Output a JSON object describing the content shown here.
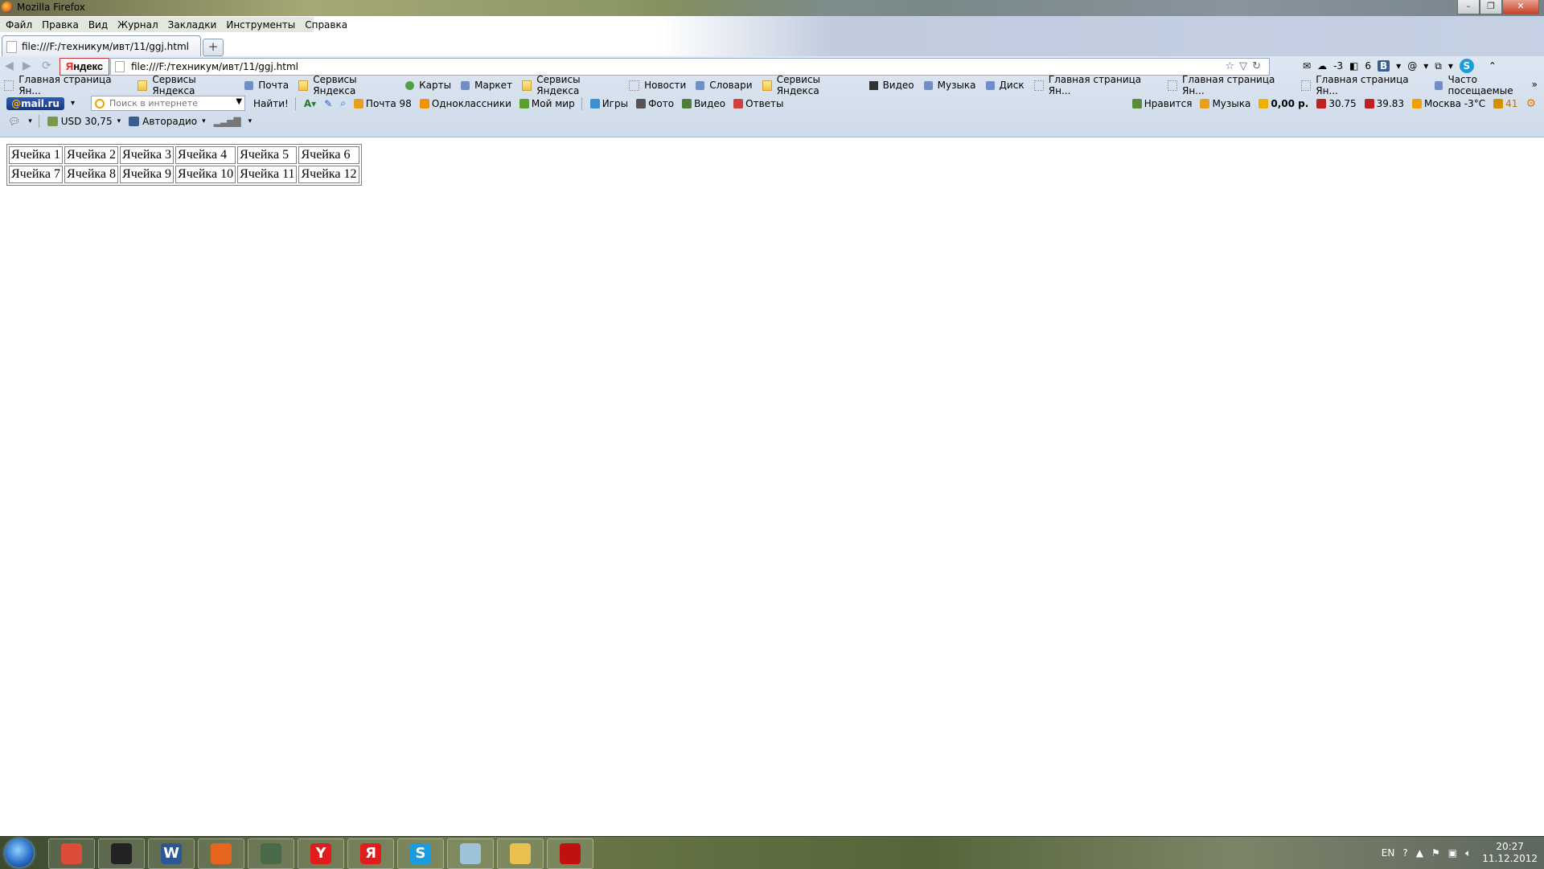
{
  "window": {
    "title": "Mozilla Firefox"
  },
  "menu": [
    "Файл",
    "Правка",
    "Вид",
    "Журнал",
    "Закладки",
    "Инструменты",
    "Справка"
  ],
  "tab": {
    "label": "file:///F:/техникум/ивт/11/ggj.html",
    "new_tab": "+"
  },
  "nav": {
    "yandex_label_first": "Я",
    "yandex_label_rest": "ндекс",
    "url": "file:///F:/техникум/ивт/11/ggj.html",
    "weather": "-3",
    "notif_count": "6"
  },
  "bookmarks": [
    {
      "label": "Главная страница Ян...",
      "icon": "page-icon"
    },
    {
      "label": "Сервисы Яндекса",
      "icon": "folder-icon"
    },
    {
      "label": "Почта",
      "icon": "mail-icon"
    },
    {
      "label": "Сервисы Яндекса",
      "icon": "folder-icon"
    },
    {
      "label": "Карты",
      "icon": "maps-icon"
    },
    {
      "label": "Маркет",
      "icon": "market-icon"
    },
    {
      "label": "Сервисы Яндекса",
      "icon": "folder-icon"
    },
    {
      "label": "Новости",
      "icon": "news-icon"
    },
    {
      "label": "Словари",
      "icon": "dictionary-icon"
    },
    {
      "label": "Сервисы Яндекса",
      "icon": "folder-icon"
    },
    {
      "label": "Видео",
      "icon": "video-icon"
    },
    {
      "label": "Музыка",
      "icon": "music-icon"
    },
    {
      "label": "Диск",
      "icon": "disk-icon"
    },
    {
      "label": "Главная страница Ян...",
      "icon": "page-icon"
    },
    {
      "label": "Главная страница Ян...",
      "icon": "page-icon"
    },
    {
      "label": "Главная страница Ян...",
      "icon": "page-icon"
    },
    {
      "label": "Часто посещаемые",
      "icon": "frequent-icon"
    }
  ],
  "mailbar": {
    "logo_at": "@",
    "logo_text": "mail.ru",
    "search_placeholder": "Поиск в интернете",
    "find_button": "Найти!",
    "items": [
      {
        "label": "Почта 98",
        "icon": "mail-icon",
        "color": "#e8a020"
      },
      {
        "label": "Одноклассники",
        "icon": "odnoklassniki-icon",
        "color": "#f39200"
      },
      {
        "label": "Мой мир",
        "icon": "my-world-icon",
        "color": "#5aa02c"
      },
      {
        "label": "Игры",
        "icon": "games-icon",
        "color": "#3a8fd0"
      },
      {
        "label": "Фото",
        "icon": "camera-icon",
        "color": "#555555"
      },
      {
        "label": "Видео",
        "icon": "video-icon",
        "color": "#4f7e3a"
      },
      {
        "label": "Ответы",
        "icon": "answers-icon",
        "color": "#d04040"
      }
    ],
    "right": [
      {
        "label": "Нравится",
        "icon": "like-icon",
        "color": "#5a8a3a"
      },
      {
        "label": "Музыка",
        "icon": "music-icon",
        "color": "#e8a020"
      },
      {
        "label": "0,00 р.",
        "icon": "wallet-icon",
        "color": "#f0b000"
      },
      {
        "label": "30.75",
        "icon": "dollar-icon",
        "color": "#c02020"
      },
      {
        "label": "39.83",
        "icon": "euro-icon",
        "color": "#c02020"
      },
      {
        "label": "Москва -3°C",
        "icon": "weather-icon",
        "color": "#f0a000"
      },
      {
        "label": "41",
        "icon": "game-hero-icon",
        "color": "#d09000"
      }
    ]
  },
  "thirdbar": {
    "currency": "USD 30,75",
    "radio": "Авторадио"
  },
  "table": {
    "rows": [
      [
        "Ячейка 1",
        "Ячейка 2",
        "Ячейка 3",
        "Ячейка 4",
        "Ячейка 5",
        "Ячейка 6"
      ],
      [
        "Ячейка 7",
        "Ячейка 8",
        "Ячейка 9",
        "Ячейка 10",
        "Ячейка 11",
        "Ячейка 12"
      ]
    ]
  },
  "taskbar": {
    "apps": [
      {
        "name": "chrome-icon",
        "glyph": "",
        "color": "#dd4b39"
      },
      {
        "name": "winamp-icon",
        "glyph": "",
        "color": "#222222"
      },
      {
        "name": "word-icon",
        "glyph": "W",
        "color": "#2b5797"
      },
      {
        "name": "firefox-icon",
        "glyph": "",
        "color": "#e8651d"
      },
      {
        "name": "device-manager-icon",
        "glyph": "",
        "color": "#4a6a4a"
      },
      {
        "name": "yandex-browser-icon",
        "glyph": "Y",
        "color": "#e21c1c"
      },
      {
        "name": "yandex-icon",
        "glyph": "Я",
        "color": "#e21c1c"
      },
      {
        "name": "skype-icon",
        "glyph": "S",
        "color": "#1a9de0"
      },
      {
        "name": "notepad-icon",
        "glyph": "",
        "color": "#9cc3d8"
      },
      {
        "name": "explorer-icon",
        "glyph": "",
        "color": "#e8c050"
      },
      {
        "name": "acrobat-icon",
        "glyph": "",
        "color": "#c01010"
      }
    ],
    "lang": "EN",
    "time": "20:27",
    "date": "11.12.2012"
  }
}
